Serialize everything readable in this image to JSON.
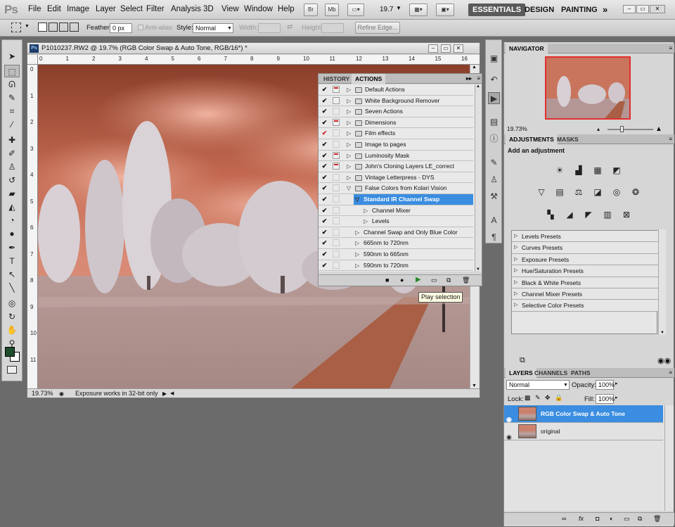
{
  "app": {
    "logo": "Ps"
  },
  "menu": [
    "File",
    "Edit",
    "Image",
    "Layer",
    "Select",
    "Filter",
    "Analysis",
    "3D",
    "View",
    "Window",
    "Help"
  ],
  "appbar": {
    "bridge": "Br",
    "minibridge": "Mb",
    "zoom": "19.7",
    "workspaces": [
      "ESSENTIALS",
      "DESIGN",
      "PAINTING"
    ]
  },
  "options": {
    "feather_label": "Feather:",
    "feather_value": "0 px",
    "antialias_label": "Anti-alias",
    "style_label": "Style:",
    "style_value": "Normal",
    "width_label": "Width:",
    "height_label": "Height:",
    "refine_edge": "Refine Edge..."
  },
  "document": {
    "title": "P1010237.RW2 @ 19.7% (RGB Color Swap & Auto Tone, RGB/16*) *",
    "ruler_h": [
      "0",
      "1",
      "2",
      "3",
      "4",
      "5",
      "6",
      "7",
      "8",
      "9",
      "10",
      "11",
      "12",
      "13",
      "14",
      "15",
      "16"
    ],
    "ruler_v": [
      "0",
      "1",
      "2",
      "3",
      "4",
      "5",
      "6",
      "7",
      "8",
      "9",
      "10",
      "11"
    ],
    "zoom": "19.73%",
    "status": "Exposure works in 32-bit only"
  },
  "actions_panel": {
    "tabs": [
      "HISTORY",
      "ACTIONS"
    ],
    "rows": [
      {
        "label": "Default Actions",
        "check": "✔",
        "dialog": "red",
        "level": 0,
        "folder": true,
        "expanded": false
      },
      {
        "label": "White Background Remover",
        "check": "✔",
        "dialog": "plain",
        "level": 0,
        "folder": true,
        "expanded": false
      },
      {
        "label": "Seven Actions",
        "check": "✔",
        "dialog": "none",
        "level": 0,
        "folder": true,
        "expanded": false
      },
      {
        "label": "Dimensions",
        "check": "✔",
        "dialog": "red",
        "level": 0,
        "folder": true,
        "expanded": false
      },
      {
        "label": "Film effects",
        "check": "✔",
        "dialog": "none",
        "level": 0,
        "folder": true,
        "expanded": false,
        "checkRed": true
      },
      {
        "label": "Image to  pages",
        "check": "✔",
        "dialog": "none",
        "level": 0,
        "folder": true,
        "expanded": false
      },
      {
        "label": "Luminosity Mask",
        "check": "✔",
        "dialog": "red",
        "level": 0,
        "folder": true,
        "expanded": false
      },
      {
        "label": "John's Cloning Layers LE_correct",
        "check": "✔",
        "dialog": "red",
        "level": 0,
        "folder": true,
        "expanded": false
      },
      {
        "label": "Vintage Letterpress - DYS",
        "check": "✔",
        "dialog": "none",
        "level": 0,
        "folder": true,
        "expanded": false
      },
      {
        "label": "False Colors from Kolari Vision",
        "check": "✔",
        "dialog": "none",
        "level": 0,
        "folder": true,
        "expanded": true
      },
      {
        "label": "Standard IR Channel Swap",
        "check": "✔",
        "dialog": "none",
        "level": 1,
        "folder": false,
        "expanded": true,
        "selected": true
      },
      {
        "label": "Channel Mixer",
        "check": "✔",
        "dialog": "none",
        "level": 2,
        "folder": false,
        "expanded": false
      },
      {
        "label": "Levels",
        "check": "✔",
        "dialog": "none",
        "level": 2,
        "folder": false,
        "expanded": false
      },
      {
        "label": "Channel Swap and Only Blue Color",
        "check": "✔",
        "dialog": "none",
        "level": 1,
        "folder": false,
        "expanded": false
      },
      {
        "label": "665nm to 720nm",
        "check": "✔",
        "dialog": "none",
        "level": 1,
        "folder": false,
        "expanded": false
      },
      {
        "label": "590nm to 665nm",
        "check": "✔",
        "dialog": "none",
        "level": 1,
        "folder": false,
        "expanded": false
      },
      {
        "label": "590nm to 720nm",
        "check": "✔",
        "dialog": "none",
        "level": 1,
        "folder": false,
        "expanded": false
      }
    ],
    "tooltip": "Play selection"
  },
  "navigator": {
    "tab": "NAVIGATOR",
    "zoom": "19.73%"
  },
  "adjustments": {
    "tabs": [
      "ADJUSTMENTS",
      "MASKS"
    ],
    "heading": "Add an adjustment",
    "presets": [
      "Levels Presets",
      "Curves Presets",
      "Exposure Presets",
      "Hue/Saturation Presets",
      "Black & White Presets",
      "Channel Mixer Presets",
      "Selective Color Presets"
    ]
  },
  "layers": {
    "tabs": [
      "LAYERS",
      "CHANNELS",
      "PATHS"
    ],
    "blend_mode": "Normal",
    "opacity_label": "Opacity:",
    "opacity": "100%",
    "lock_label": "Lock:",
    "fill_label": "Fill:",
    "fill": "100%",
    "items": [
      {
        "name": "RGB Color Swap & Auto Tone",
        "selected": true
      },
      {
        "name": "original",
        "selected": false
      }
    ]
  },
  "colors": {
    "accent": "#3a8de0",
    "foreground": "#1d4d2a",
    "background": "#ffffff"
  }
}
